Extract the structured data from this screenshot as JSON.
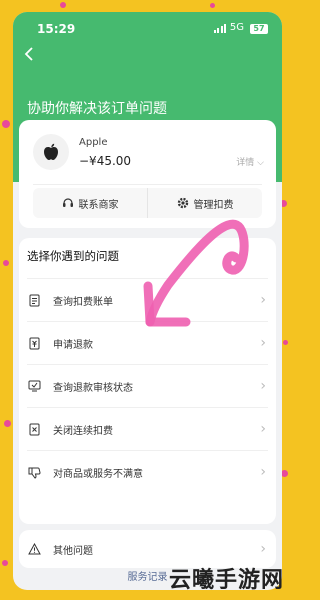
{
  "status_bar": {
    "time": "15:29",
    "network": "5G",
    "battery": "57"
  },
  "page": {
    "title": "协助你解决该订单问题"
  },
  "order": {
    "merchant": "Apple",
    "amount": "−¥45.00",
    "detail_label": "详情",
    "contact_label": "联系商家",
    "manage_label": "管理扣费"
  },
  "problems": {
    "title": "选择你遇到的问题",
    "items": [
      {
        "label": "查询扣费账单",
        "icon": "bill-icon"
      },
      {
        "label": "申请退款",
        "icon": "refund-icon"
      },
      {
        "label": "查询退款审核状态",
        "icon": "review-status-icon"
      },
      {
        "label": "关闭连续扣费",
        "icon": "stop-autopay-icon"
      },
      {
        "label": "对商品或服务不满意",
        "icon": "dislike-icon"
      }
    ],
    "other": {
      "label": "其他问题",
      "icon": "warning-icon"
    }
  },
  "footer": {
    "records_label": "服务记录"
  },
  "watermark": "云曦手游网",
  "colors": {
    "green": "#46ba6f",
    "background": "#f4c321",
    "arrow": "#ee5fb0",
    "link": "#576b95"
  }
}
